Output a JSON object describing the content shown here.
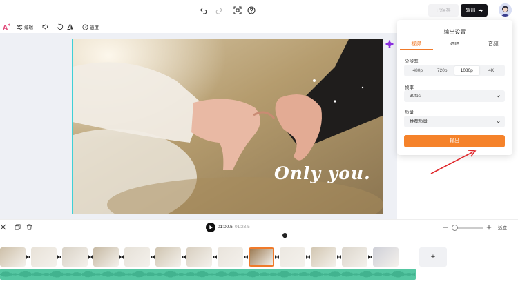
{
  "topbar": {
    "saved_label": "已保存",
    "export_label": "输出",
    "icons": [
      "undo-icon",
      "redo-icon",
      "screen-fit-icon",
      "help-icon",
      "arrow-right-icon"
    ]
  },
  "toolbar": {
    "edit_label": "编辑",
    "speed_label": "速度",
    "icons": [
      "ai-edit-icon",
      "sliders-icon",
      "volume-icon",
      "rotate-icon",
      "flip-icon",
      "speedometer-icon"
    ]
  },
  "canvas": {
    "caption": "Only you."
  },
  "export_panel": {
    "title": "输出设置",
    "tabs": [
      {
        "label": "视频",
        "active": true
      },
      {
        "label": "GIF",
        "active": false
      },
      {
        "label": "音频",
        "active": false
      }
    ],
    "resolution": {
      "label": "分辨率",
      "options": [
        {
          "label": "480p",
          "active": false
        },
        {
          "label": "720p",
          "active": false
        },
        {
          "label": "1080p",
          "active": true
        },
        {
          "label": "4K",
          "active": false
        }
      ]
    },
    "framerate": {
      "label": "帧率",
      "value": "30fps"
    },
    "quality": {
      "label": "质量",
      "value": "推荐质量"
    },
    "export_button": "输出"
  },
  "timeline": {
    "current_time": "01:00.5",
    "separator": "/",
    "total_time": "01:23.5",
    "fit_label": "适应",
    "add_label": "+",
    "zoom_level": 0.1,
    "clip_count": 13,
    "selected_clip_index": 8
  },
  "colors": {
    "accent": "#f5822a",
    "frame_outline": "#3fd0d6",
    "audio": "#55c7a2",
    "arrow": "#e0282c"
  }
}
